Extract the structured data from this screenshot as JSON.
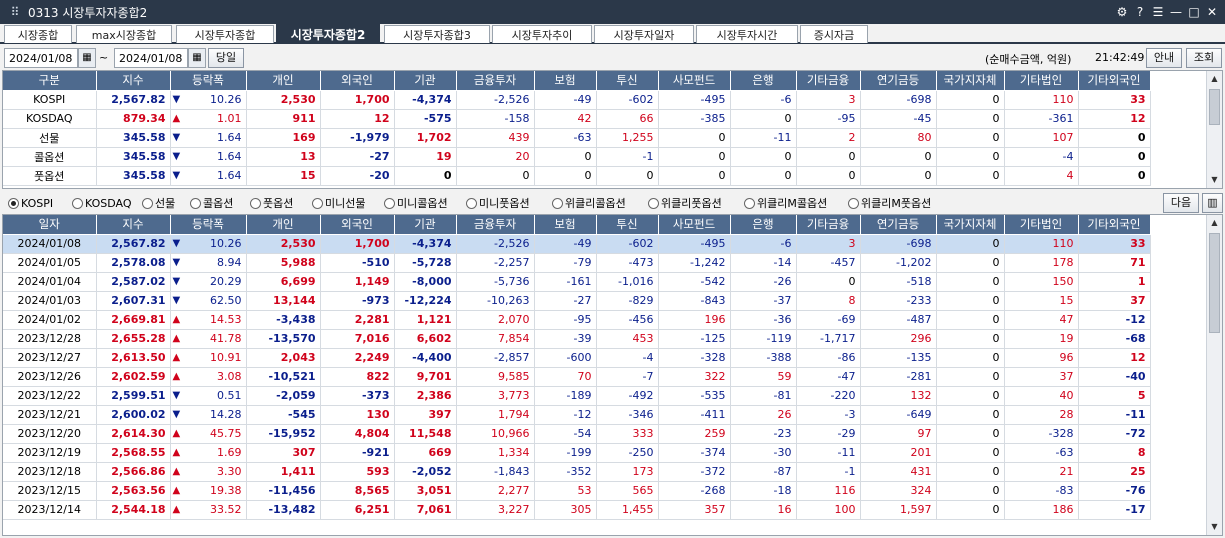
{
  "window": {
    "title": "0313 시장투자자종합2",
    "menu_icon": "grid-icon",
    "controls": [
      "⚙",
      "?",
      "☰",
      "—",
      "□",
      "✕"
    ]
  },
  "tabs": [
    {
      "label": "시장종합",
      "active": false
    },
    {
      "label": "max시장종합",
      "active": false
    },
    {
      "label": "시장투자종합",
      "active": false
    },
    {
      "label": "시장투자종합2",
      "active": true
    },
    {
      "label": "시장투자종합3",
      "active": false
    },
    {
      "label": "시장투자추이",
      "active": false
    },
    {
      "label": "시장투자일자",
      "active": false
    },
    {
      "label": "시장투자시간",
      "active": false
    },
    {
      "label": "증시자금",
      "active": false
    }
  ],
  "toolbar": {
    "date_from": "2024/01/08",
    "separator": "~",
    "date_to": "2024/01/08",
    "today_button": "당일",
    "unit_note": "(순매수금액, 억원)",
    "time": "21:42:49",
    "guide_button": "안내",
    "query_button": "조회",
    "next_button": "다음",
    "chart_button_icon": "bar-chart-icon"
  },
  "colors": {
    "header_bg": "#4e6a8e",
    "up": "#d0021b",
    "down": "#0a1e8c",
    "selected_row": "#c9dcf2"
  },
  "summary": {
    "columns": [
      "구분",
      "지수",
      "등락폭",
      "개인",
      "외국인",
      "기관",
      "금융투자",
      "보험",
      "투신",
      "사모펀드",
      "은행",
      "기타금융",
      "연기금등",
      "국가지자체",
      "기타법인",
      "기타외국인"
    ],
    "rows": [
      {
        "name": "KOSPI",
        "index": "2,567.82",
        "dir": "down",
        "chg": "10.26",
        "v": [
          "2,530",
          "1,700",
          "-4,374",
          "-2,526",
          "-49",
          "-602",
          "-495",
          "-6",
          "3",
          "-698",
          "0",
          "110",
          "33"
        ]
      },
      {
        "name": "KOSDAQ",
        "index": "879.34",
        "dir": "up",
        "chg": "1.01",
        "v": [
          "911",
          "12",
          "-575",
          "-158",
          "42",
          "66",
          "-385",
          "0",
          "-95",
          "-45",
          "0",
          "-361",
          "12"
        ]
      },
      {
        "name": "선물",
        "index": "345.58",
        "dir": "down",
        "chg": "1.64",
        "v": [
          "169",
          "-1,979",
          "1,702",
          "439",
          "-63",
          "1,255",
          "0",
          "-11",
          "2",
          "80",
          "0",
          "107",
          "0"
        ]
      },
      {
        "name": "콜옵션",
        "index": "345.58",
        "dir": "down",
        "chg": "1.64",
        "v": [
          "13",
          "-27",
          "19",
          "20",
          "0",
          "-1",
          "0",
          "0",
          "0",
          "0",
          "0",
          "-4",
          "0"
        ]
      },
      {
        "name": "풋옵션",
        "index": "345.58",
        "dir": "down",
        "chg": "1.64",
        "v": [
          "15",
          "-20",
          "0",
          "0",
          "0",
          "0",
          "0",
          "0",
          "0",
          "0",
          "0",
          "4",
          "0"
        ]
      }
    ]
  },
  "radios": [
    {
      "label": "KOSPI",
      "checked": true
    },
    {
      "label": "KOSDAQ",
      "checked": false
    },
    {
      "label": "선물",
      "checked": false
    },
    {
      "label": "콜옵션",
      "checked": false
    },
    {
      "label": "풋옵션",
      "checked": false
    },
    {
      "label": "미니선물",
      "checked": false
    },
    {
      "label": "미니콜옵션",
      "checked": false
    },
    {
      "label": "미니풋옵션",
      "checked": false
    },
    {
      "label": "위클리콜옵션",
      "checked": false
    },
    {
      "label": "위클리풋옵션",
      "checked": false
    },
    {
      "label": "위클리M콜옵션",
      "checked": false
    },
    {
      "label": "위클리M풋옵션",
      "checked": false
    }
  ],
  "daily": {
    "columns": [
      "일자",
      "지수",
      "등락폭",
      "개인",
      "외국인",
      "기관",
      "금융투자",
      "보험",
      "투신",
      "사모펀드",
      "은행",
      "기타금융",
      "연기금등",
      "국가지자체",
      "기타법인",
      "기타외국인"
    ],
    "rows": [
      {
        "date": "2024/01/08",
        "index": "2,567.82",
        "dir": "down",
        "chg": "10.26",
        "v": [
          "2,530",
          "1,700",
          "-4,374",
          "-2,526",
          "-49",
          "-602",
          "-495",
          "-6",
          "3",
          "-698",
          "0",
          "110",
          "33"
        ]
      },
      {
        "date": "2024/01/05",
        "index": "2,578.08",
        "dir": "down",
        "chg": "8.94",
        "v": [
          "5,988",
          "-510",
          "-5,728",
          "-2,257",
          "-79",
          "-473",
          "-1,242",
          "-14",
          "-457",
          "-1,202",
          "0",
          "178",
          "71"
        ]
      },
      {
        "date": "2024/01/04",
        "index": "2,587.02",
        "dir": "down",
        "chg": "20.29",
        "v": [
          "6,699",
          "1,149",
          "-8,000",
          "-5,736",
          "-161",
          "-1,016",
          "-542",
          "-26",
          "0",
          "-518",
          "0",
          "150",
          "1"
        ]
      },
      {
        "date": "2024/01/03",
        "index": "2,607.31",
        "dir": "down",
        "chg": "62.50",
        "v": [
          "13,144",
          "-973",
          "-12,224",
          "-10,263",
          "-27",
          "-829",
          "-843",
          "-37",
          "8",
          "-233",
          "0",
          "15",
          "37"
        ]
      },
      {
        "date": "2024/01/02",
        "index": "2,669.81",
        "dir": "up",
        "chg": "14.53",
        "v": [
          "-3,438",
          "2,281",
          "1,121",
          "2,070",
          "-95",
          "-456",
          "196",
          "-36",
          "-69",
          "-487",
          "0",
          "47",
          "-12"
        ]
      },
      {
        "date": "2023/12/28",
        "index": "2,655.28",
        "dir": "up",
        "chg": "41.78",
        "v": [
          "-13,570",
          "7,016",
          "6,602",
          "7,854",
          "-39",
          "453",
          "-125",
          "-119",
          "-1,717",
          "296",
          "0",
          "19",
          "-68"
        ]
      },
      {
        "date": "2023/12/27",
        "index": "2,613.50",
        "dir": "up",
        "chg": "10.91",
        "v": [
          "2,043",
          "2,249",
          "-4,400",
          "-2,857",
          "-600",
          "-4",
          "-328",
          "-388",
          "-86",
          "-135",
          "0",
          "96",
          "12"
        ]
      },
      {
        "date": "2023/12/26",
        "index": "2,602.59",
        "dir": "up",
        "chg": "3.08",
        "v": [
          "-10,521",
          "822",
          "9,701",
          "9,585",
          "70",
          "-7",
          "322",
          "59",
          "-47",
          "-281",
          "0",
          "37",
          "-40"
        ]
      },
      {
        "date": "2023/12/22",
        "index": "2,599.51",
        "dir": "down",
        "chg": "0.51",
        "v": [
          "-2,059",
          "-373",
          "2,386",
          "3,773",
          "-189",
          "-492",
          "-535",
          "-81",
          "-220",
          "132",
          "0",
          "40",
          "5"
        ]
      },
      {
        "date": "2023/12/21",
        "index": "2,600.02",
        "dir": "down",
        "chg": "14.28",
        "v": [
          "-545",
          "130",
          "397",
          "1,794",
          "-12",
          "-346",
          "-411",
          "26",
          "-3",
          "-649",
          "0",
          "28",
          "-11"
        ]
      },
      {
        "date": "2023/12/20",
        "index": "2,614.30",
        "dir": "up",
        "chg": "45.75",
        "v": [
          "-15,952",
          "4,804",
          "11,548",
          "10,966",
          "-54",
          "333",
          "259",
          "-23",
          "-29",
          "97",
          "0",
          "-328",
          "-72"
        ]
      },
      {
        "date": "2023/12/19",
        "index": "2,568.55",
        "dir": "up",
        "chg": "1.69",
        "v": [
          "307",
          "-921",
          "669",
          "1,334",
          "-199",
          "-250",
          "-374",
          "-30",
          "-11",
          "201",
          "0",
          "-63",
          "8"
        ]
      },
      {
        "date": "2023/12/18",
        "index": "2,566.86",
        "dir": "up",
        "chg": "3.30",
        "v": [
          "1,411",
          "593",
          "-2,052",
          "-1,843",
          "-352",
          "173",
          "-372",
          "-87",
          "-1",
          "431",
          "0",
          "21",
          "25"
        ]
      },
      {
        "date": "2023/12/15",
        "index": "2,563.56",
        "dir": "up",
        "chg": "19.38",
        "v": [
          "-11,456",
          "8,565",
          "3,051",
          "2,277",
          "53",
          "565",
          "-268",
          "-18",
          "116",
          "324",
          "0",
          "-83",
          "-76"
        ]
      },
      {
        "date": "2023/12/14",
        "index": "2,544.18",
        "dir": "up",
        "chg": "33.52",
        "v": [
          "-13,482",
          "6,251",
          "7,061",
          "3,227",
          "305",
          "1,455",
          "357",
          "16",
          "100",
          "1,597",
          "0",
          "186",
          "-17"
        ]
      }
    ]
  }
}
